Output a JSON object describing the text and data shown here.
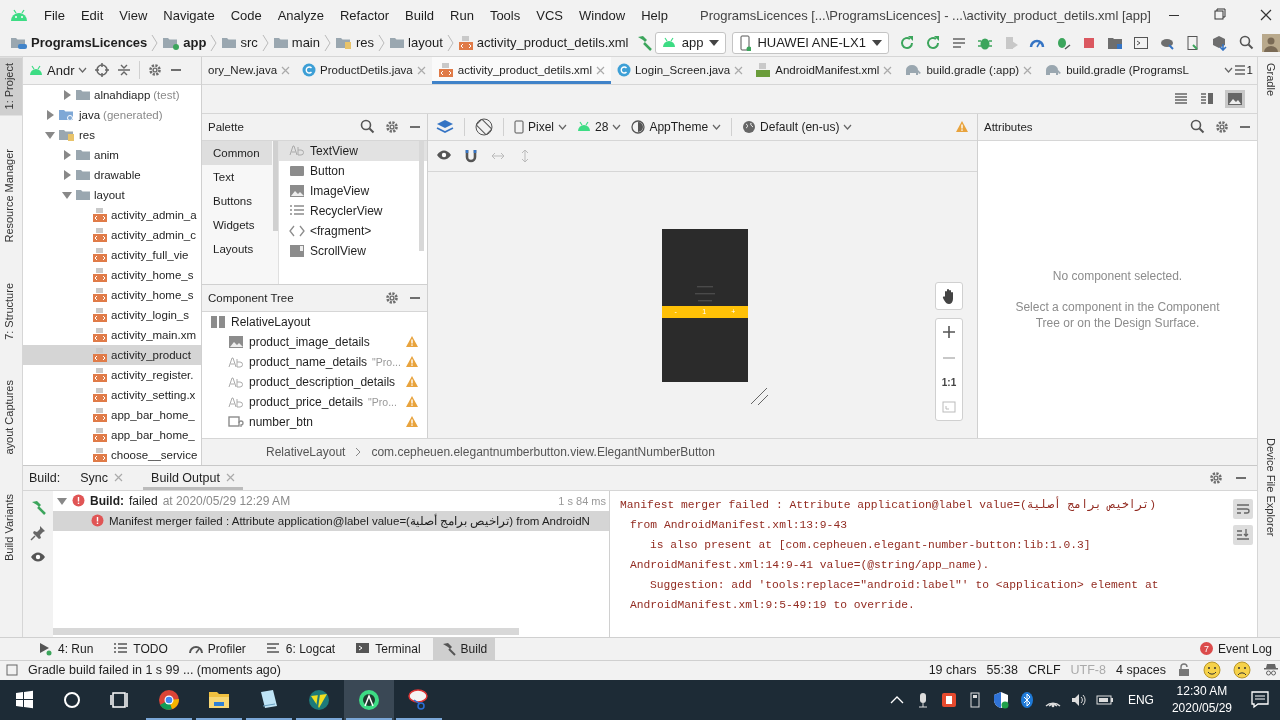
{
  "window": {
    "title": "ProgramsLicences [...\\ProgramsLicences] - ...\\activity_product_detils.xml [app]"
  },
  "menu": [
    "File",
    "Edit",
    "View",
    "Navigate",
    "Code",
    "Analyze",
    "Refactor",
    "Build",
    "Run",
    "Tools",
    "VCS",
    "Window",
    "Help"
  ],
  "breadcrumbs": [
    {
      "label": "ProgramsLicences",
      "kind": "project"
    },
    {
      "label": "app",
      "kind": "module"
    },
    {
      "label": "src",
      "kind": "folder"
    },
    {
      "label": "main",
      "kind": "folder"
    },
    {
      "label": "res",
      "kind": "res"
    },
    {
      "label": "layout",
      "kind": "folder"
    },
    {
      "label": "activity_product_detils.xml",
      "kind": "layout"
    }
  ],
  "run_config": "app",
  "device": "HUAWEI ANE-LX1",
  "left_stripe": [
    {
      "label": "1: Project",
      "selected": true
    },
    {
      "label": "Resource Manager",
      "selected": false
    },
    {
      "label": "7: Structure",
      "selected": false
    },
    {
      "label": "ayout Captures",
      "selected": false
    },
    {
      "label": "Build Variants",
      "selected": false
    }
  ],
  "right_stripe": [
    {
      "label": "Gradle"
    },
    {
      "label": "Device File Explorer"
    }
  ],
  "project_panel": {
    "view": "Andr",
    "tree": [
      {
        "label": "alnahdiapp",
        "suffix": "(test)",
        "kind": "package",
        "expanded": false,
        "selected": false
      },
      {
        "label": "java",
        "suffix": "(generated)",
        "kind": "generated",
        "expanded": false,
        "selected": false
      },
      {
        "label": "res",
        "kind": "res",
        "expanded": true,
        "selected": false,
        "children": [
          {
            "label": "anim",
            "kind": "folder",
            "expanded": false,
            "selected": false
          },
          {
            "label": "drawable",
            "kind": "folder",
            "expanded": false,
            "selected": false
          },
          {
            "label": "layout",
            "kind": "folder",
            "expanded": true,
            "selected": false,
            "children": [
              {
                "label": "activity_admin_a",
                "kind": "layout",
                "selected": false
              },
              {
                "label": "activity_admin_c",
                "kind": "layout",
                "selected": false
              },
              {
                "label": "activity_full_vie",
                "kind": "layout",
                "selected": false
              },
              {
                "label": "activity_home_s",
                "kind": "layout",
                "selected": false
              },
              {
                "label": "activity_home_s",
                "kind": "layout",
                "selected": false
              },
              {
                "label": "activity_login_s",
                "kind": "layout",
                "selected": false
              },
              {
                "label": "activity_main.xm",
                "kind": "layout",
                "selected": false
              },
              {
                "label": "activity_product",
                "kind": "layout",
                "selected": true
              },
              {
                "label": "activity_register.",
                "kind": "layout",
                "selected": false
              },
              {
                "label": "activity_setting.x",
                "kind": "layout",
                "selected": false
              },
              {
                "label": "app_bar_home_",
                "kind": "layout",
                "selected": false
              },
              {
                "label": "app_bar_home_",
                "kind": "layout",
                "selected": false
              },
              {
                "label": "choose__service",
                "kind": "layout",
                "selected": false
              }
            ]
          }
        ]
      }
    ]
  },
  "editor_tabs": [
    {
      "label": "ory_New.java",
      "kind": "none",
      "selected": false,
      "closable": true
    },
    {
      "label": "ProductDetils.java",
      "kind": "class",
      "selected": false,
      "closable": true
    },
    {
      "label": "activity_product_detils.xml",
      "kind": "layout",
      "selected": true,
      "closable": true
    },
    {
      "label": "Login_Screen.java",
      "kind": "class",
      "selected": false,
      "closable": true
    },
    {
      "label": "AndroidManifest.xml",
      "kind": "manifest",
      "selected": false,
      "closable": true
    },
    {
      "label": "build.gradle (:app)",
      "kind": "gradle",
      "selected": false,
      "closable": true
    },
    {
      "label": "build.gradle (ProgramsL",
      "kind": "gradle",
      "selected": false,
      "closable": false
    }
  ],
  "tab_overflow": "1",
  "palette": {
    "title": "Palette",
    "categories": [
      {
        "label": "Common",
        "selected": true
      },
      {
        "label": "Text",
        "selected": false
      },
      {
        "label": "Buttons",
        "selected": false
      },
      {
        "label": "Widgets",
        "selected": false
      },
      {
        "label": "Layouts",
        "selected": false
      }
    ],
    "widgets": [
      {
        "label": "TextView",
        "kind": "text",
        "selected": true
      },
      {
        "label": "Button",
        "kind": "button",
        "selected": false
      },
      {
        "label": "ImageView",
        "kind": "image",
        "selected": false
      },
      {
        "label": "RecyclerView",
        "kind": "list",
        "selected": false
      },
      {
        "label": "<fragment>",
        "kind": "fragment",
        "selected": false
      },
      {
        "label": "ScrollView",
        "kind": "scroll",
        "selected": false
      }
    ]
  },
  "component_tree": {
    "title": "Component Tree",
    "nodes": [
      {
        "label": "RelativeLayout",
        "kind": "layout",
        "warning": false,
        "children": [
          {
            "label": "product_image_details",
            "kind": "image",
            "warning": true
          },
          {
            "label": "product_name_details",
            "hint": "\"Pro...",
            "kind": "text",
            "warning": true
          },
          {
            "label": "product_description_details",
            "kind": "text",
            "warning": true
          },
          {
            "label": "product_price_details",
            "hint": "\"Pro...",
            "kind": "text",
            "warning": true
          },
          {
            "label": "number_btn",
            "kind": "custom",
            "warning": true
          }
        ]
      }
    ]
  },
  "design_toolbar": {
    "device": "Pixel",
    "api": "28",
    "theme": "AppTheme",
    "locale": "Default (en-us)",
    "warning": true
  },
  "preview": {
    "stepper": [
      "-",
      "1",
      "+"
    ]
  },
  "zoom_controls": {
    "actual_size": "1:1"
  },
  "attributes": {
    "title": "Attributes",
    "empty_title": "No component selected.",
    "empty_hint": "Select a component in the Component Tree or on the Design Surface."
  },
  "selection_path": [
    "RelativeLayout",
    "com.cepheuen.elegantnumberbutton.view.ElegantNumberButton"
  ],
  "build_panel": {
    "label": "Build:",
    "tabs": [
      {
        "label": "Sync",
        "selected": false
      },
      {
        "label": "Build Output",
        "selected": true
      }
    ],
    "tree": [
      {
        "title": "Build:",
        "status": "failed",
        "time": "at 2020/05/29 12:29 AM",
        "duration": "1 s 84 ms",
        "expanded": true,
        "children": [
          {
            "text": "Manifest merger failed : Attribute application@label value=(تراخيص برامج أصلية) from AndroidN",
            "selected": true
          }
        ]
      }
    ],
    "console": [
      {
        "text": "Manifest merger failed : Attribute application@label value=(تراخيص برامج أصلية)",
        "kind": "message"
      },
      {
        "text": "from AndroidManifest.xml:13:9-43",
        "kind": "location"
      },
      {
        "text": "is also present at [com.cepheuen.elegant-number-button:lib:1.0.3]",
        "kind": "note"
      },
      {
        "text": "AndroidManifest.xml:14:9-41 value=(@string/app_name).",
        "kind": "location"
      },
      {
        "text": "Suggestion: add 'tools:replace=\"android:label\"' to <application> element at",
        "kind": "note"
      },
      {
        "text": "AndroidManifest.xml:9:5-49:19 to override.",
        "kind": "location"
      }
    ]
  },
  "tool_windows": [
    {
      "label": "4: Run",
      "kind": "run",
      "selected": false
    },
    {
      "label": "TODO",
      "kind": "todo",
      "selected": false
    },
    {
      "label": "Profiler",
      "kind": "profiler",
      "selected": false
    },
    {
      "label": "6: Logcat",
      "kind": "logcat",
      "selected": false
    },
    {
      "label": "Terminal",
      "kind": "terminal",
      "selected": false
    },
    {
      "label": "Build",
      "kind": "build",
      "selected": true
    }
  ],
  "event_log": {
    "label": "Event Log",
    "count": "7"
  },
  "status_bar": {
    "message": "Gradle build failed in 1 s 99 ... (moments ago)",
    "items": [
      {
        "text": "19 chars",
        "disabled": false
      },
      {
        "text": "55:38",
        "disabled": false
      },
      {
        "text": "CRLF",
        "disabled": false
      },
      {
        "text": "UTF-8",
        "disabled": true
      },
      {
        "text": "4 spaces",
        "disabled": false
      }
    ]
  },
  "taskbar": {
    "apps": [
      {
        "kind": "chrome",
        "selected": false
      },
      {
        "kind": "explorer",
        "selected": false
      },
      {
        "kind": "notepad",
        "selected": false
      },
      {
        "kind": "editor",
        "selected": false
      },
      {
        "kind": "studio",
        "selected": true
      },
      {
        "kind": "snip",
        "selected": false
      }
    ],
    "language": "ENG",
    "time": "12:30 AM",
    "date": "2020/05/29"
  }
}
